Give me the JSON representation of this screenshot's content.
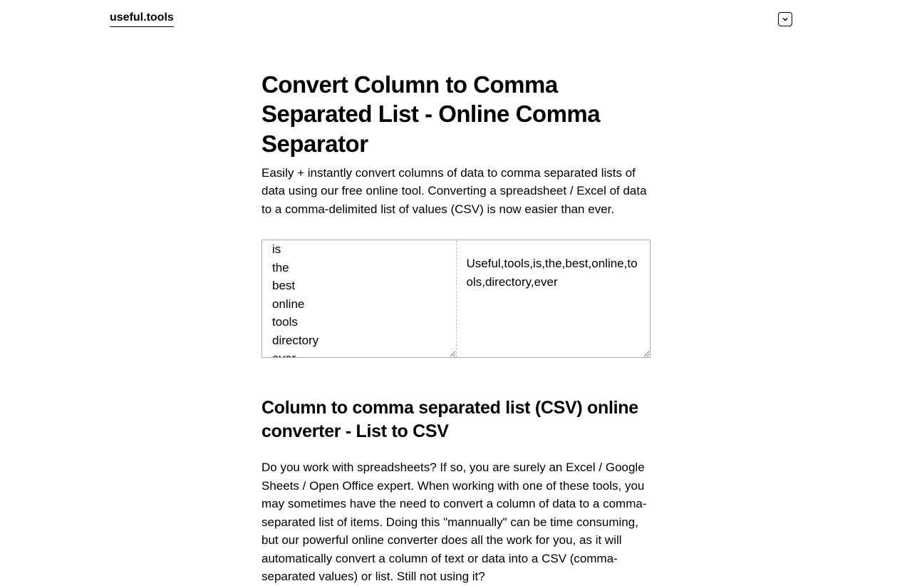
{
  "header": {
    "logo": "useful.tools"
  },
  "page": {
    "title": "Convert Column to Comma Separated List - Online Comma Separator",
    "subtitle": "Easily + instantly convert columns of data to comma separated lists of data using our free online tool. Converting a spreadsheet / Excel of data to a comma-delimited list of values (CSV) is now easier than ever."
  },
  "converter": {
    "input": "is\nthe\nbest\nonline\ntools\ndirectory\never",
    "output": "Useful,tools,is,the,best,online,tools,directory,ever"
  },
  "section": {
    "heading": "Column to comma separated list (CSV) online converter - List to CSV",
    "body": "Do you work with spreadsheets? If so, you are surely an Excel / Google Sheets / Open Office expert. When working with one of these tools, you may sometimes have the need to convert a column of data to a comma-separated list of items. Doing this \"mannually\" can be time consuming, but our powerful online converter does all the work for you, as it will automatically convert a column of text or data into a CSV (comma-separated values) or list. Still not using it?"
  }
}
